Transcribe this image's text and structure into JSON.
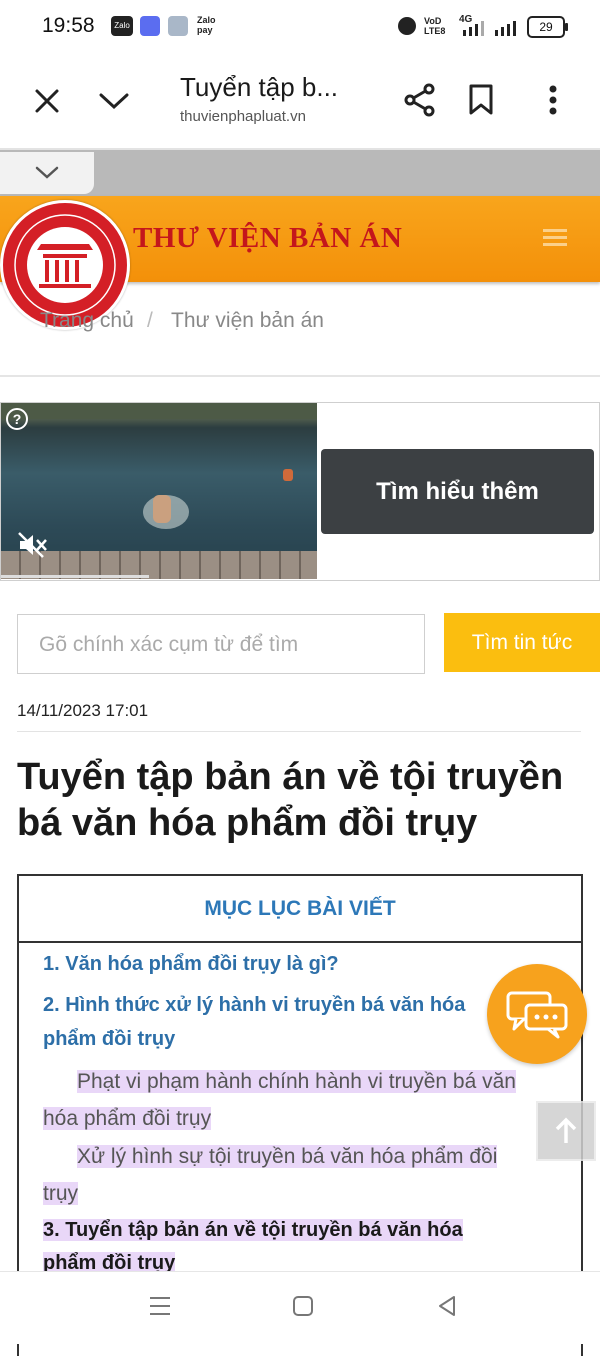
{
  "status_bar": {
    "time": "19:58",
    "app_icons": [
      "zalo-icon",
      "cloud-icon",
      "message-icon",
      "zalopay-icon"
    ],
    "zalopay_label": "Zalo pay",
    "network_label_1": "VoD LTE8",
    "network_label_2": "4G",
    "battery": "29"
  },
  "browser": {
    "title": "Tuyển tập b...",
    "url": "thuvienphapluat.vn"
  },
  "banner": {
    "title": "THƯ VIỆN BẢN ÁN",
    "brand_color": "#c4161c",
    "accent": "#f7a01a"
  },
  "breadcrumb": {
    "home": "Trang chủ",
    "separator": "/",
    "current": "Thư viện bản án"
  },
  "ad": {
    "cta": "Tìm hiểu thêm"
  },
  "search": {
    "placeholder": "Gõ chính xác cụm từ để tìm",
    "button": "Tìm tin tức"
  },
  "article": {
    "date": "14/11/2023 17:01",
    "title": "Tuyển tập bản án về tội truyền bá văn hóa phẩm đồi trụy"
  },
  "toc": {
    "heading": "MỤC LỤC BÀI VIẾT",
    "item1": "1. Văn hóa phẩm đồi trụy là gì?",
    "item2_line1": "2. Hình thức xử lý hành vi truyền bá văn hóa",
    "item2_line2": "phẩm đồi trụy",
    "sub1_line1": "Phạt vi phạm hành chính hành vi truyền bá văn",
    "sub1_line2": "hóa phẩm đồi trụy",
    "sub2_line1": "Xử lý hình sự tội truyền bá văn hóa phẩm đồi",
    "sub2_line2": "trụy",
    "item3_line1": "3. Tuyển tập bản án về tội truyền bá văn hóa",
    "item3_line2": "phẩm đồi trụy"
  }
}
